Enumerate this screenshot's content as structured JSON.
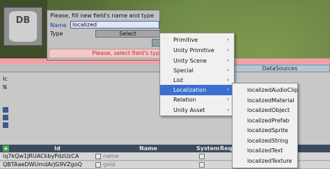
{
  "dialog": {
    "prompt": "Please, fill new field's name and type",
    "name_label": "Name",
    "name_value": "localized",
    "type_label": "Type",
    "type_select": "Select",
    "error": "Please, select field's type"
  },
  "editor": {
    "datasources_tab": "DataSources",
    "left_labels": [
      "Ic",
      "N"
    ],
    "grid": {
      "add": "+",
      "columns": {
        "id": "Id",
        "name": "Name",
        "system": "System",
        "required": "Requ"
      },
      "rows": [
        {
          "id": "iq7kQw1JRUACkbyPdzUzCA",
          "name": "name"
        },
        {
          "id": "QBTAaeDWUmdArJG9VZgoQ",
          "name": "gold"
        }
      ]
    }
  },
  "menu": {
    "items": [
      {
        "label": "Primitive",
        "arrow": "›"
      },
      {
        "label": "Unity Primitive",
        "arrow": "›"
      },
      {
        "label": "Unity Scene",
        "arrow": "›"
      },
      {
        "label": "Special",
        "arrow": "›"
      },
      {
        "label": "List",
        "arrow": "›"
      },
      {
        "label": "Localization",
        "arrow": "›"
      },
      {
        "label": "Relation",
        "arrow": "›"
      },
      {
        "label": "Unity Asset",
        "arrow": "›"
      }
    ],
    "highlighted": "Localization"
  },
  "submenu": {
    "items": [
      "localizedAudioClip",
      "localizedMaterial",
      "localizedObject",
      "localizedPrefab",
      "localizedSprite",
      "localizedString",
      "localizedText",
      "localizedTexture"
    ]
  },
  "logo": {
    "text": "DB"
  }
}
